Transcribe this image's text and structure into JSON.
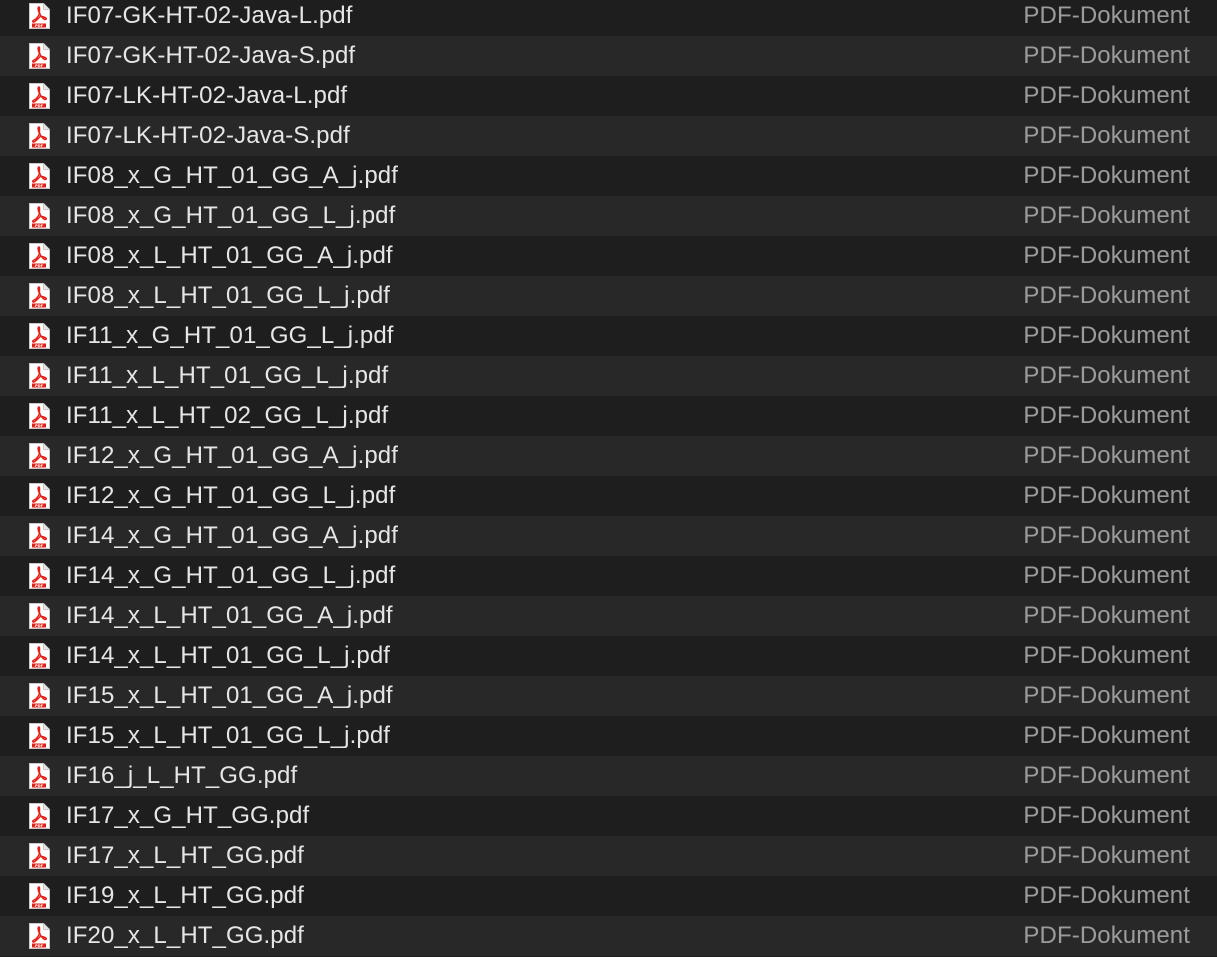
{
  "kind_label": "PDF-Dokument",
  "icon": "pdf-document-icon",
  "colors": {
    "row_odd": "#1e1e1e",
    "row_even": "#282828",
    "name_text": "#e6e6e6",
    "kind_text": "#9c9c9c",
    "pdf_red": "#e2231a"
  },
  "files": [
    {
      "name": "IF07-GK-HT-02-Java-L.pdf",
      "kind": "PDF-Dokument"
    },
    {
      "name": "IF07-GK-HT-02-Java-S.pdf",
      "kind": "PDF-Dokument"
    },
    {
      "name": "IF07-LK-HT-02-Java-L.pdf",
      "kind": "PDF-Dokument"
    },
    {
      "name": "IF07-LK-HT-02-Java-S.pdf",
      "kind": "PDF-Dokument"
    },
    {
      "name": "IF08_x_G_HT_01_GG_A_j.pdf",
      "kind": "PDF-Dokument"
    },
    {
      "name": "IF08_x_G_HT_01_GG_L_j.pdf",
      "kind": "PDF-Dokument"
    },
    {
      "name": "IF08_x_L_HT_01_GG_A_j.pdf",
      "kind": "PDF-Dokument"
    },
    {
      "name": "IF08_x_L_HT_01_GG_L_j.pdf",
      "kind": "PDF-Dokument"
    },
    {
      "name": "IF11_x_G_HT_01_GG_L_j.pdf",
      "kind": "PDF-Dokument"
    },
    {
      "name": "IF11_x_L_HT_01_GG_L_j.pdf",
      "kind": "PDF-Dokument"
    },
    {
      "name": "IF11_x_L_HT_02_GG_L_j.pdf",
      "kind": "PDF-Dokument"
    },
    {
      "name": "IF12_x_G_HT_01_GG_A_j.pdf",
      "kind": "PDF-Dokument"
    },
    {
      "name": "IF12_x_G_HT_01_GG_L_j.pdf",
      "kind": "PDF-Dokument"
    },
    {
      "name": "IF14_x_G_HT_01_GG_A_j.pdf",
      "kind": "PDF-Dokument"
    },
    {
      "name": "IF14_x_G_HT_01_GG_L_j.pdf",
      "kind": "PDF-Dokument"
    },
    {
      "name": "IF14_x_L_HT_01_GG_A_j.pdf",
      "kind": "PDF-Dokument"
    },
    {
      "name": "IF14_x_L_HT_01_GG_L_j.pdf",
      "kind": "PDF-Dokument"
    },
    {
      "name": "IF15_x_L_HT_01_GG_A_j.pdf",
      "kind": "PDF-Dokument"
    },
    {
      "name": "IF15_x_L_HT_01_GG_L_j.pdf",
      "kind": "PDF-Dokument"
    },
    {
      "name": "IF16_j_L_HT_GG.pdf",
      "kind": "PDF-Dokument"
    },
    {
      "name": "IF17_x_G_HT_GG.pdf",
      "kind": "PDF-Dokument"
    },
    {
      "name": "IF17_x_L_HT_GG.pdf",
      "kind": "PDF-Dokument"
    },
    {
      "name": "IF19_x_L_HT_GG.pdf",
      "kind": "PDF-Dokument"
    },
    {
      "name": "IF20_x_L_HT_GG.pdf",
      "kind": "PDF-Dokument"
    }
  ]
}
